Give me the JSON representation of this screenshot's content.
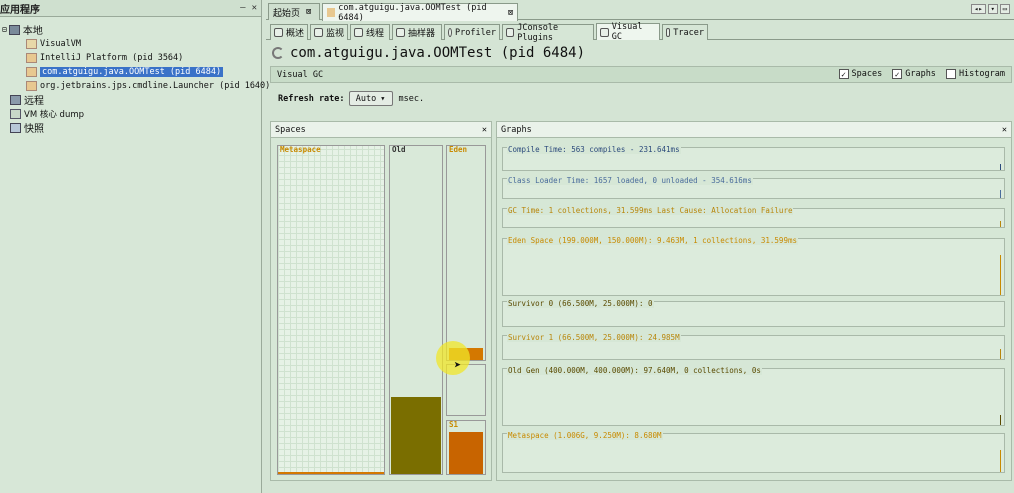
{
  "left_panel": {
    "title": "应用程序",
    "tree": {
      "local": "本地",
      "visualvm": "VisualVM",
      "intellij": "IntelliJ Platform (pid 3564)",
      "oomtest": "com.atguigu.java.OOMTest (pid 6484)",
      "launcher": "org.jetbrains.jps.cmdline.Launcher (pid 1640)",
      "remote": "远程",
      "vmdump": "VM 核心 dump",
      "snapshots": "快照"
    }
  },
  "top_tabs": {
    "start": "起始页",
    "app": "com.atguigu.java.OOMTest (pid 6484)"
  },
  "sub_tabs": [
    "概述",
    "监视",
    "线程",
    "抽样器",
    "Profiler",
    "JConsole Plugins",
    "Visual GC",
    "Tracer"
  ],
  "page_title": "com.atguigu.java.OOMTest (pid 6484)",
  "visual_gc": {
    "label": "Visual GC",
    "checkboxes": [
      {
        "label": "Spaces",
        "checked": true
      },
      {
        "label": "Graphs",
        "checked": true
      },
      {
        "label": "Histogram",
        "checked": false
      }
    ],
    "refresh_label": "Refresh rate:",
    "refresh_value": "Auto",
    "refresh_unit": "msec."
  },
  "spaces": {
    "title": "Spaces",
    "metaspace": "Metaspace",
    "old": "Old",
    "eden": "Eden",
    "s1": "S1"
  },
  "graphs": {
    "title": "Graphs",
    "rows": [
      {
        "label": "Compile Time: 563 compiles - 231.641ms",
        "color": "#2c4a7c"
      },
      {
        "label": "Class Loader Time: 1657 loaded, 0 unloaded - 354.616ms",
        "color": "#4a6c9c"
      },
      {
        "label": "GC Time: 1 collections, 31.599ms Last Cause: Allocation Failure",
        "color": "#b8860b"
      },
      {
        "label": "Eden Space (199.000M, 150.000M): 9.463M, 1 collections, 31.599ms",
        "color": "#c88a00"
      },
      {
        "label": "Survivor 0 (66.500M, 25.000M): 0",
        "color": "#5a4a00"
      },
      {
        "label": "Survivor 1 (66.500M, 25.000M): 24.985M",
        "color": "#b8860b"
      },
      {
        "label": "Old Gen (400.000M, 400.000M): 97.640M, 0 collections, 0s",
        "color": "#5a4a00"
      },
      {
        "label": "Metaspace (1.006G, 9.250M): 8.680M",
        "color": "#c88a00"
      }
    ]
  },
  "colors": {
    "accent": "#3a72c8",
    "old_fill": "#7a6e00",
    "survivor_fill": "#c86400",
    "eden_fill": "#d47800"
  }
}
